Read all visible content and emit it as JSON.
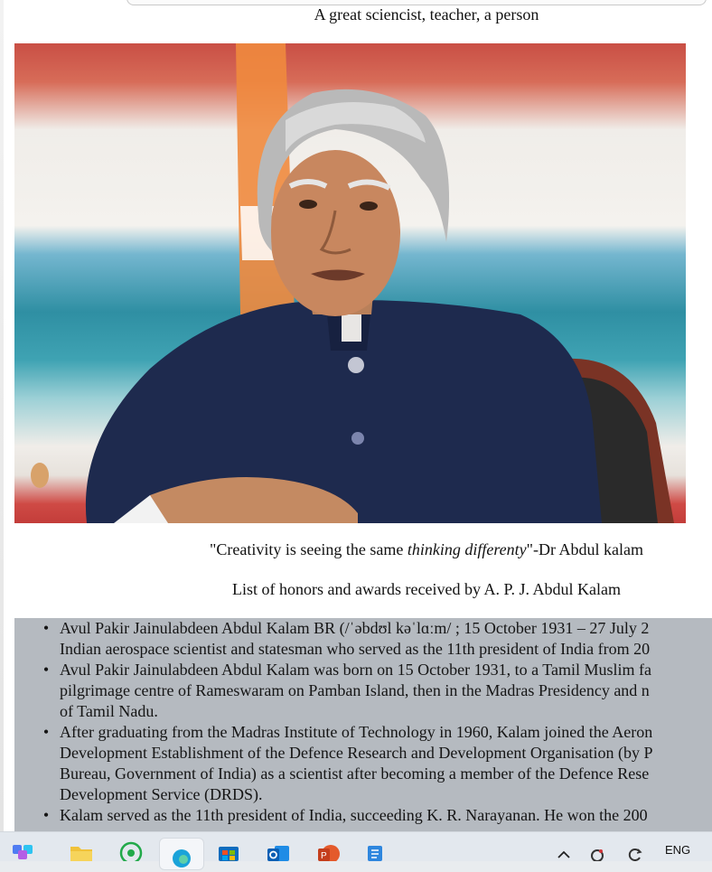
{
  "header": {
    "tagline": "A great sciencist, teacher, a person"
  },
  "photo": {
    "icon": "portrait-photo"
  },
  "quote": {
    "before": "\"Creativity is seeing the same ",
    "italic": "thinking differenty",
    "after": "\"-Dr Abdul kalam"
  },
  "honors": {
    "title": "List of honors and awards received by A. P. J. Abdul Kalam",
    "items": [
      [
        "Avul Pakir Jainulabdeen Abdul Kalam BR (/ˈəbdʊl kəˈlɑːm/ ; 15 October 1931 – 27 July 2",
        "Indian aerospace scientist and statesman who served as the 11th president of India from 20"
      ],
      [
        "Avul Pakir Jainulabdeen Abdul Kalam was born on 15 October 1931, to a Tamil Muslim fa",
        "pilgrimage centre of Rameswaram on Pamban Island, then in the Madras Presidency and n",
        "of Tamil Nadu."
      ],
      [
        "After graduating from the Madras Institute of Technology in 1960, Kalam joined the Aeron",
        "Development Establishment of the Defence Research and Development Organisation (by P",
        "Bureau, Government of India) as a scientist after becoming a member of the Defence Rese",
        "Development Service (DRDS)."
      ],
      [
        "Kalam served as the 11th president of India, succeeding K. R. Narayanan. He won the 200"
      ]
    ]
  },
  "taskbar": {
    "icons": [
      "widgets-icon",
      "file-explorer-icon",
      "whatsapp-icon",
      "edge-icon",
      "store-icon",
      "outlook-icon",
      "powerpoint-icon",
      "notepad-icon"
    ],
    "tray_icons": [
      "chevron-up-icon",
      "camera-icon",
      "refresh-icon"
    ],
    "language": "ENG"
  }
}
